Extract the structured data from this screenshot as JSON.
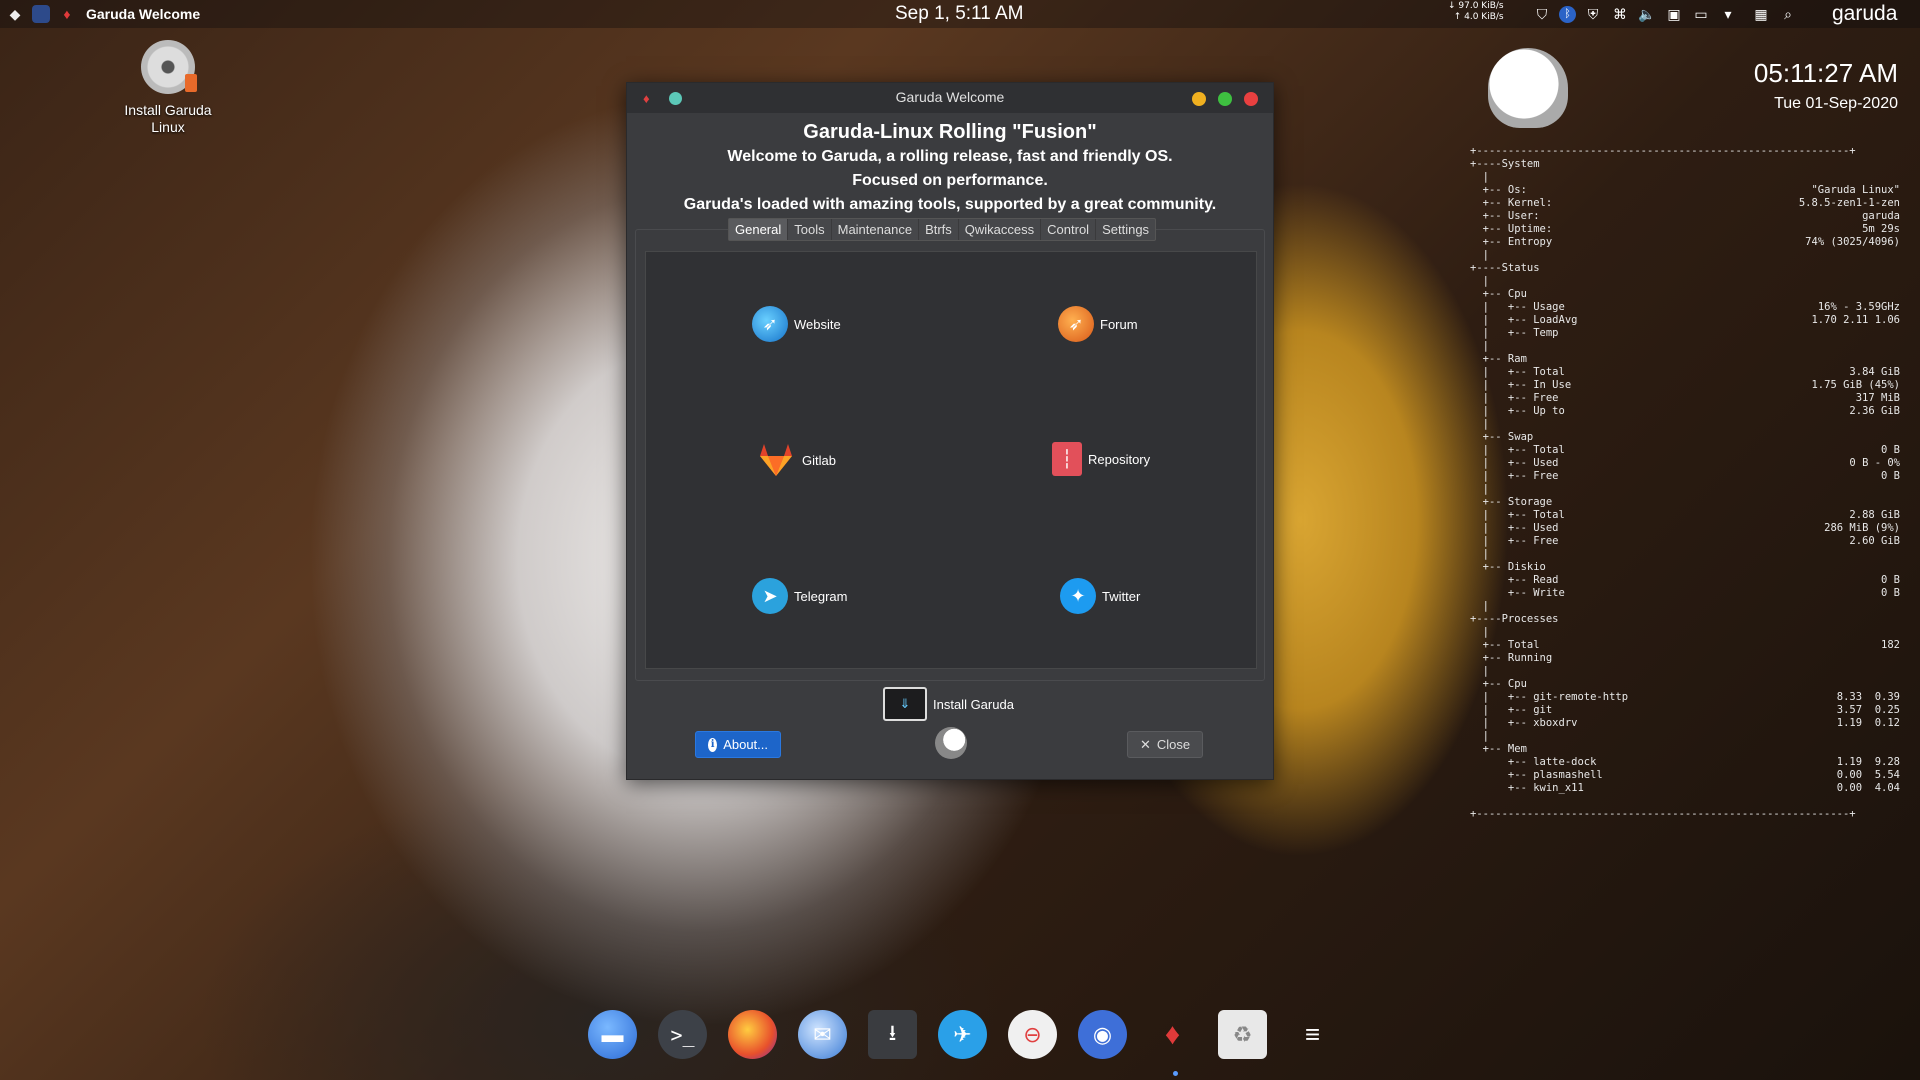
{
  "top_panel": {
    "active_window": "Garuda Welcome",
    "clock": "Sep 1, 5:11 AM",
    "net_down": "↓ 97.0 KiB/s",
    "net_up": "↑ 4.0 KiB/s",
    "username": "garuda",
    "tray_icons": [
      "shield-icon",
      "bluetooth-icon",
      "checkmark-shield-icon",
      "command-icon",
      "volume-icon",
      "clipboard-icon",
      "display-icon",
      "chevron-down-icon",
      "chip-icon",
      "search-icon"
    ]
  },
  "desktop": {
    "icons": [
      {
        "label": "Install Garuda Linux",
        "icon": "disc-installer-icon"
      }
    ]
  },
  "window": {
    "title": "Garuda Welcome",
    "header": {
      "title": "Garuda-Linux Rolling \"Fusion\"",
      "line1": "Welcome to Garuda, a rolling release, fast and friendly OS.",
      "line2": "Focused on performance.",
      "line3": "Garuda's loaded with amazing tools, supported by a great community."
    },
    "tabs": [
      "General",
      "Tools",
      "Maintenance",
      "Btrfs",
      "Qwikaccess",
      "Control",
      "Settings"
    ],
    "active_tab": "General",
    "links": [
      {
        "label": "Website"
      },
      {
        "label": "Forum"
      },
      {
        "label": "Gitlab"
      },
      {
        "label": "Repository"
      },
      {
        "label": "Telegram"
      },
      {
        "label": "Twitter"
      }
    ],
    "install_label": "Install Garuda",
    "about_label": "About...",
    "close_label": "Close",
    "close_glyph": "✕"
  },
  "conky": {
    "time": "05:11:27 AM",
    "date": "Tue 01-Sep-2020",
    "rows": [
      {
        "l": "+-----------------------------------------------------------+",
        "r": ""
      },
      {
        "l": "+----System",
        "r": ""
      },
      {
        "l": "  |",
        "r": ""
      },
      {
        "l": "  +-- Os:",
        "r": "\"Garuda Linux\""
      },
      {
        "l": "  +-- Kernel:",
        "r": "5.8.5-zen1-1-zen"
      },
      {
        "l": "  +-- User:",
        "r": "garuda"
      },
      {
        "l": "  +-- Uptime:",
        "r": "5m 29s"
      },
      {
        "l": "  +-- Entropy",
        "r": "74% (3025/4096)"
      },
      {
        "l": "  |",
        "r": ""
      },
      {
        "l": "+----Status",
        "r": ""
      },
      {
        "l": "  |",
        "r": ""
      },
      {
        "l": "  +-- Cpu",
        "r": ""
      },
      {
        "l": "  |   +-- Usage",
        "r": "16% - 3.59GHz"
      },
      {
        "l": "  |   +-- LoadAvg",
        "r": "1.70 2.11 1.06"
      },
      {
        "l": "  |   +-- Temp",
        "r": ""
      },
      {
        "l": "  |",
        "r": ""
      },
      {
        "l": "  +-- Ram",
        "r": ""
      },
      {
        "l": "  |   +-- Total",
        "r": "3.84 GiB"
      },
      {
        "l": "  |   +-- In Use",
        "r": "1.75 GiB (45%)"
      },
      {
        "l": "  |   +-- Free",
        "r": "317 MiB"
      },
      {
        "l": "  |   +-- Up to",
        "r": "2.36 GiB"
      },
      {
        "l": "  |",
        "r": ""
      },
      {
        "l": "  +-- Swap",
        "r": ""
      },
      {
        "l": "  |   +-- Total",
        "r": "0 B"
      },
      {
        "l": "  |   +-- Used",
        "r": "0 B - 0%"
      },
      {
        "l": "  |   +-- Free",
        "r": "0 B"
      },
      {
        "l": "  |",
        "r": ""
      },
      {
        "l": "  +-- Storage",
        "r": ""
      },
      {
        "l": "  |   +-- Total",
        "r": "2.88 GiB"
      },
      {
        "l": "  |   +-- Used",
        "r": "286 MiB (9%)"
      },
      {
        "l": "  |   +-- Free",
        "r": "2.60 GiB"
      },
      {
        "l": "  |",
        "r": ""
      },
      {
        "l": "  +-- Diskio",
        "r": ""
      },
      {
        "l": "      +-- Read",
        "r": "0 B"
      },
      {
        "l": "      +-- Write",
        "r": "0 B"
      },
      {
        "l": "  |",
        "r": ""
      },
      {
        "l": "+----Processes",
        "r": ""
      },
      {
        "l": "  |",
        "r": ""
      },
      {
        "l": "  +-- Total",
        "r": "182"
      },
      {
        "l": "  +-- Running",
        "r": ""
      },
      {
        "l": "  |",
        "r": ""
      },
      {
        "l": "  +-- Cpu",
        "r": ""
      },
      {
        "l": "  |   +-- git-remote-http",
        "r": "8.33  0.39"
      },
      {
        "l": "  |   +-- git",
        "r": "3.57  0.25"
      },
      {
        "l": "  |   +-- xboxdrv",
        "r": "1.19  0.12"
      },
      {
        "l": "  |",
        "r": ""
      },
      {
        "l": "  +-- Mem",
        "r": ""
      },
      {
        "l": "      +-- latte-dock",
        "r": "1.19  9.28"
      },
      {
        "l": "      +-- plasmashell",
        "r": "0.00  5.54"
      },
      {
        "l": "      +-- kwin_x11",
        "r": "0.00  4.04"
      },
      {
        "l": "",
        "r": ""
      },
      {
        "l": "+-----------------------------------------------------------+",
        "r": ""
      }
    ]
  },
  "dock": {
    "items": [
      "file-manager-icon",
      "terminal-icon",
      "firefox-icon",
      "thunderbird-icon",
      "downloader-icon",
      "bird-app-icon",
      "calculator-icon",
      "toggle-settings-icon",
      "garuda-welcome-icon",
      "trash-icon",
      "menu-icon"
    ],
    "terminal_glyph": ">_"
  }
}
